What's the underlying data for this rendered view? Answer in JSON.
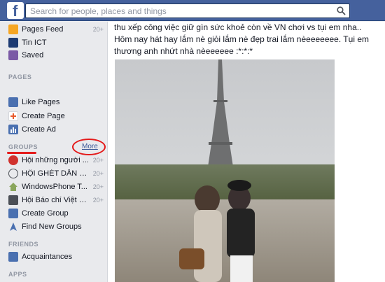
{
  "search": {
    "placeholder": "Search for people, places and things"
  },
  "sidebar": {
    "top_items": [
      {
        "label": "Pages Feed",
        "count": "20+"
      },
      {
        "label": "Tin ICT",
        "count": ""
      },
      {
        "label": "Saved",
        "count": ""
      }
    ],
    "pages_header": "PAGES",
    "pages_items": [
      {
        "label": "Like Pages"
      },
      {
        "label": "Create Page"
      },
      {
        "label": "Create Ad"
      }
    ],
    "groups_header": "GROUPS",
    "groups_more": "More",
    "groups_items": [
      {
        "label": "Hội những người ...",
        "count": "20+"
      },
      {
        "label": "HỘI GHÉT DẪN B...",
        "count": "20+"
      },
      {
        "label": "WindowsPhone T...",
        "count": "20+"
      },
      {
        "label": "Hội Báo chí Việt N...",
        "count": "20+"
      },
      {
        "label": "Create Group",
        "count": ""
      },
      {
        "label": "Find New Groups",
        "count": ""
      }
    ],
    "friends_header": "FRIENDS",
    "friends_items": [
      {
        "label": "Acquaintances"
      }
    ],
    "apps_header": "APPS"
  },
  "post": {
    "text": "thu xếp công việc giữ gìn sức khoẻ còn về VN chơi vs tụi em nha.. Hôm nay hát hay lắm nè giỏi lắm nè đẹp trai lắm nèeeeeeee. Tụi em thương anh nhứt nhà nèeeeeee :*:*:*"
  },
  "colors": {
    "brand": "#45619d",
    "link": "#3b5998",
    "annotation_red": "#e41b1b"
  }
}
